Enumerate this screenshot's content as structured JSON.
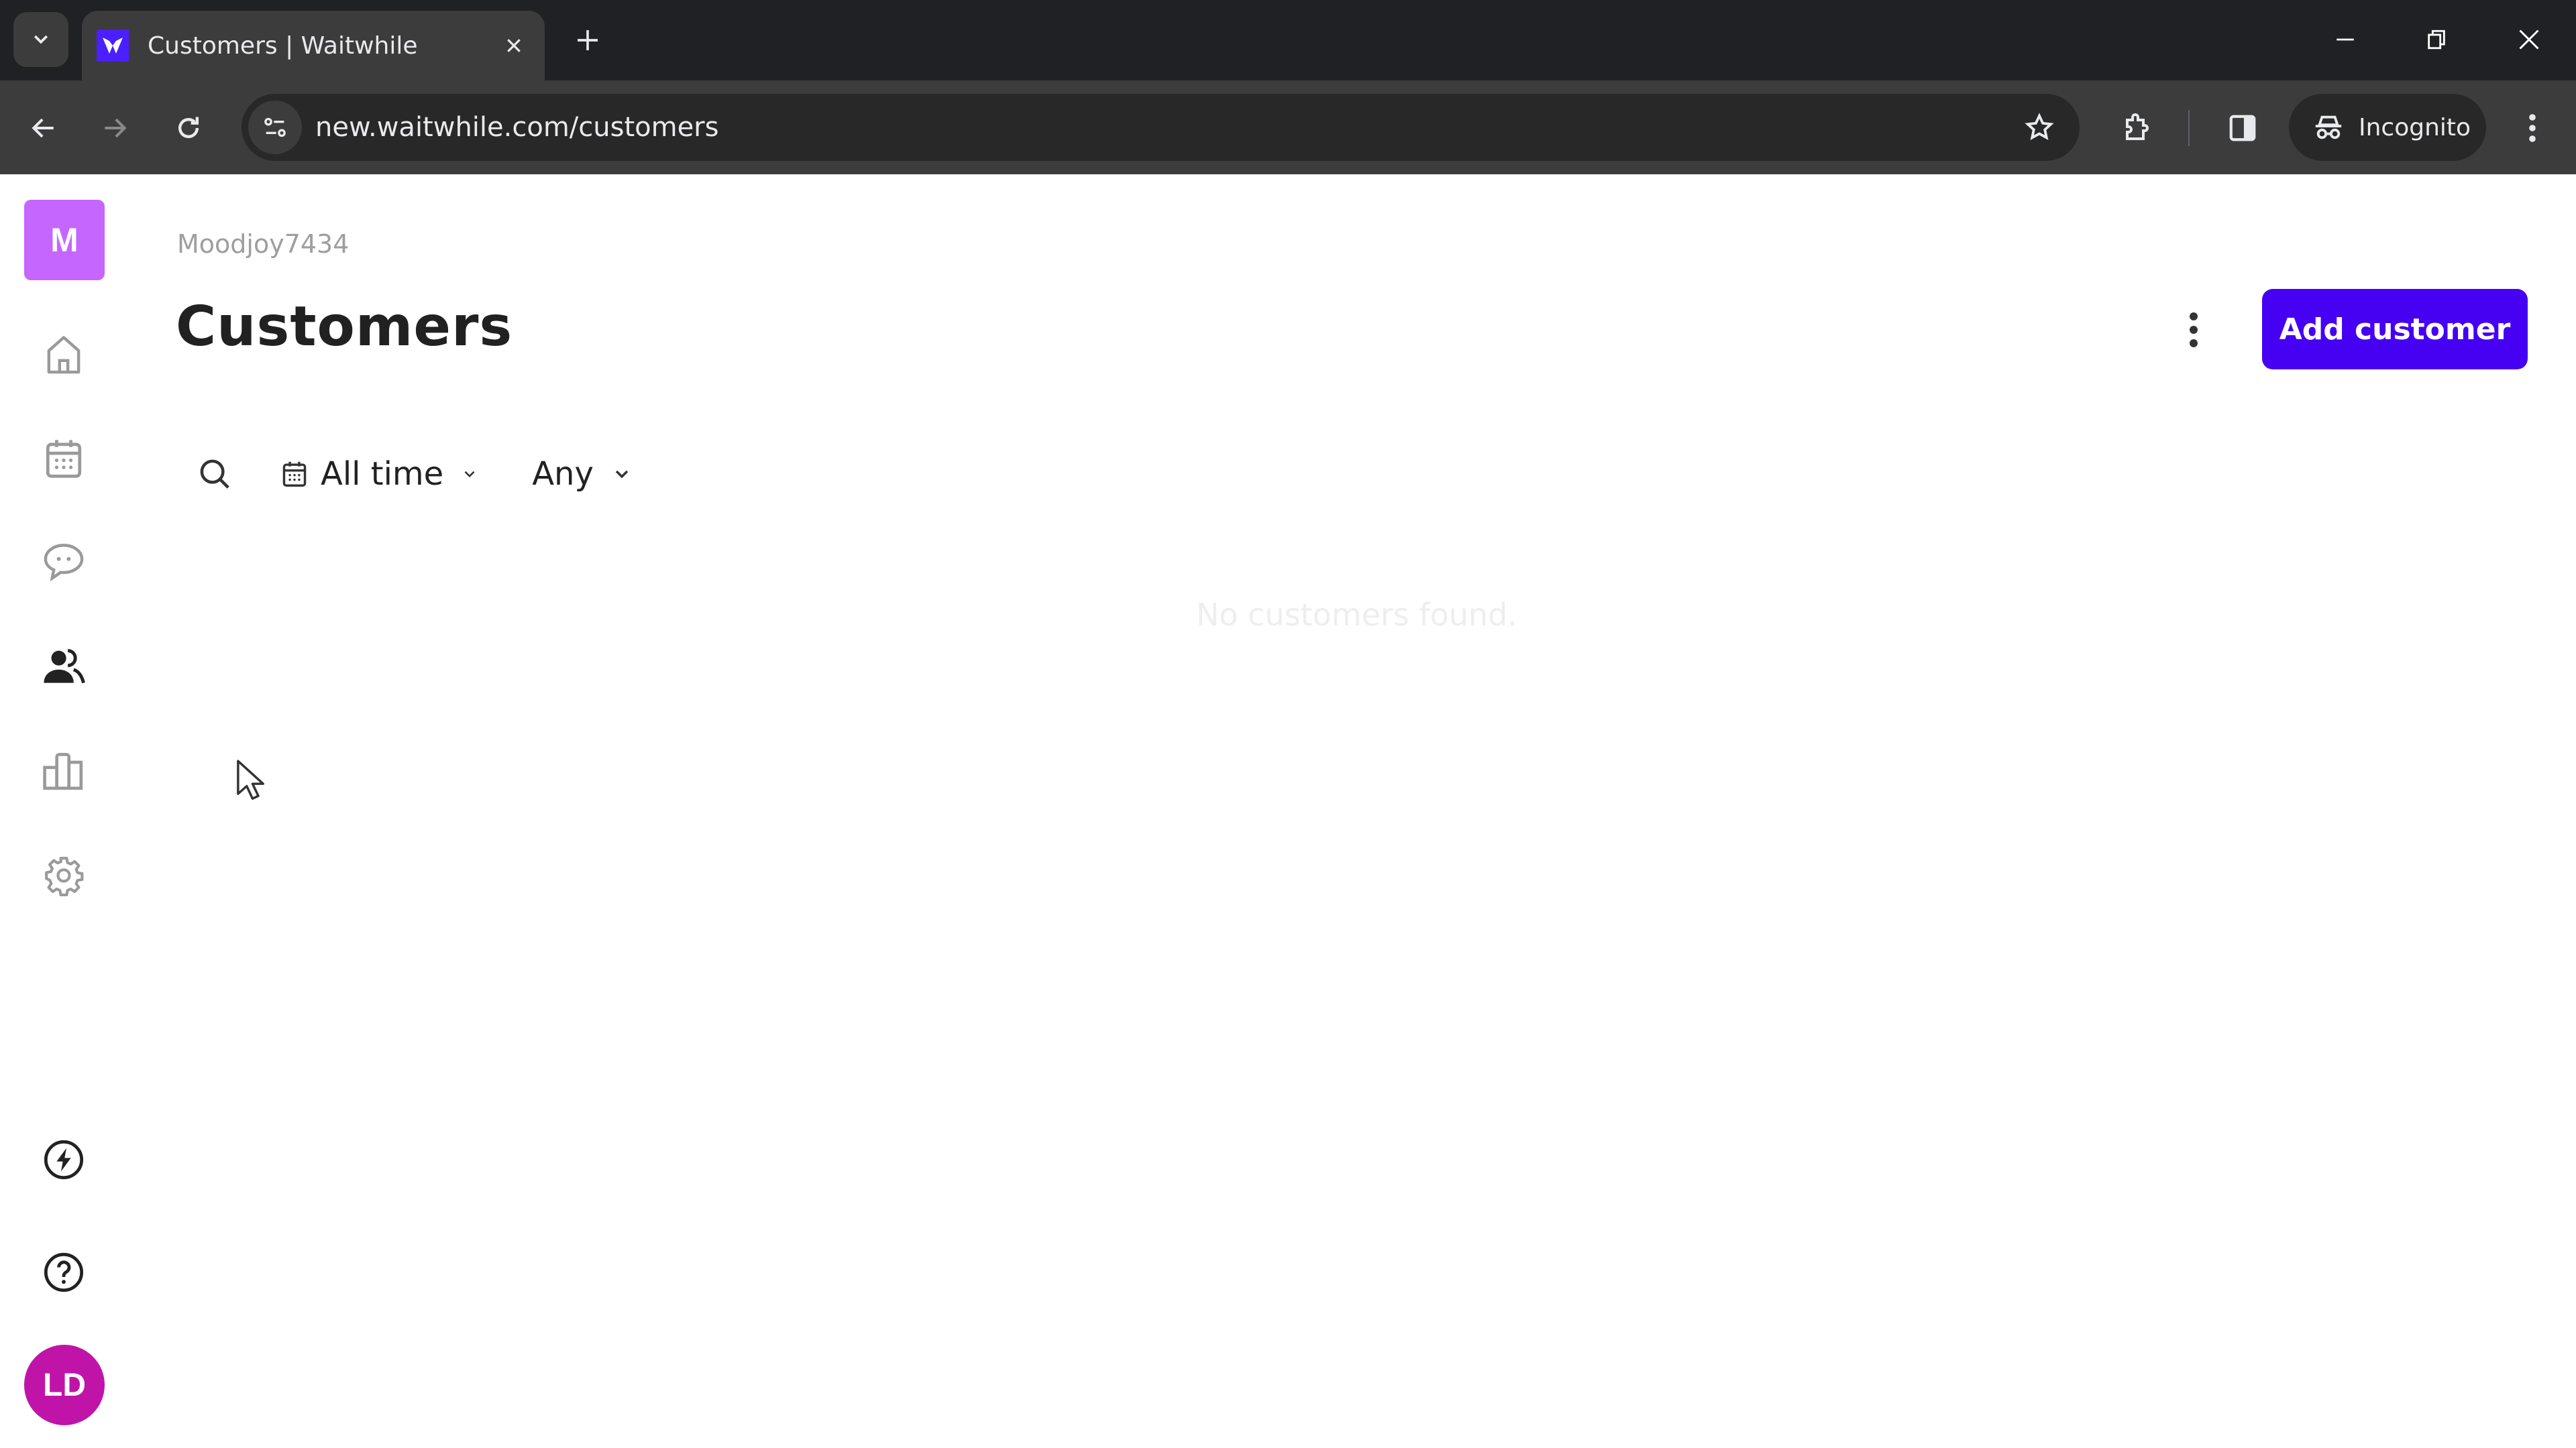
{
  "browser": {
    "tab": {
      "title": "Customers | Waitwhile",
      "favicon": "waitwhile-logo-icon"
    },
    "url": "new.waitwhile.com/customers",
    "incognito_label": "Incognito",
    "icons": [
      "tab-search-icon",
      "close-icon",
      "new-tab-icon",
      "minimize-icon",
      "restore-icon",
      "window-close-icon",
      "back-icon",
      "forward-icon",
      "reload-icon",
      "site-info-icon",
      "bookmark-star-icon",
      "extensions-icon",
      "side-panel-icon",
      "incognito-icon",
      "browser-menu-icon"
    ]
  },
  "sidebar": {
    "org_initial": "M",
    "org_color": "#c566ff",
    "items": [
      {
        "id": "home",
        "icon": "home-icon",
        "active": false
      },
      {
        "id": "calendar",
        "icon": "calendar-icon",
        "active": false
      },
      {
        "id": "messages",
        "icon": "chat-icon",
        "active": false
      },
      {
        "id": "customers",
        "icon": "users-icon",
        "active": true
      },
      {
        "id": "analytics",
        "icon": "bar-chart-icon",
        "active": false
      },
      {
        "id": "settings",
        "icon": "gear-icon",
        "active": false
      }
    ],
    "bottom": [
      {
        "id": "whats-new",
        "icon": "lightning-icon"
      },
      {
        "id": "help",
        "icon": "help-icon"
      }
    ],
    "user_initials": "LD",
    "user_color": "#c014a8"
  },
  "header": {
    "org_name": "Moodjoy7434",
    "title": "Customers",
    "add_button_label": "Add customer",
    "accent_color": "#4600f2"
  },
  "filters": {
    "date_range": "All time",
    "status": "Any"
  },
  "empty_state": "No customers found."
}
